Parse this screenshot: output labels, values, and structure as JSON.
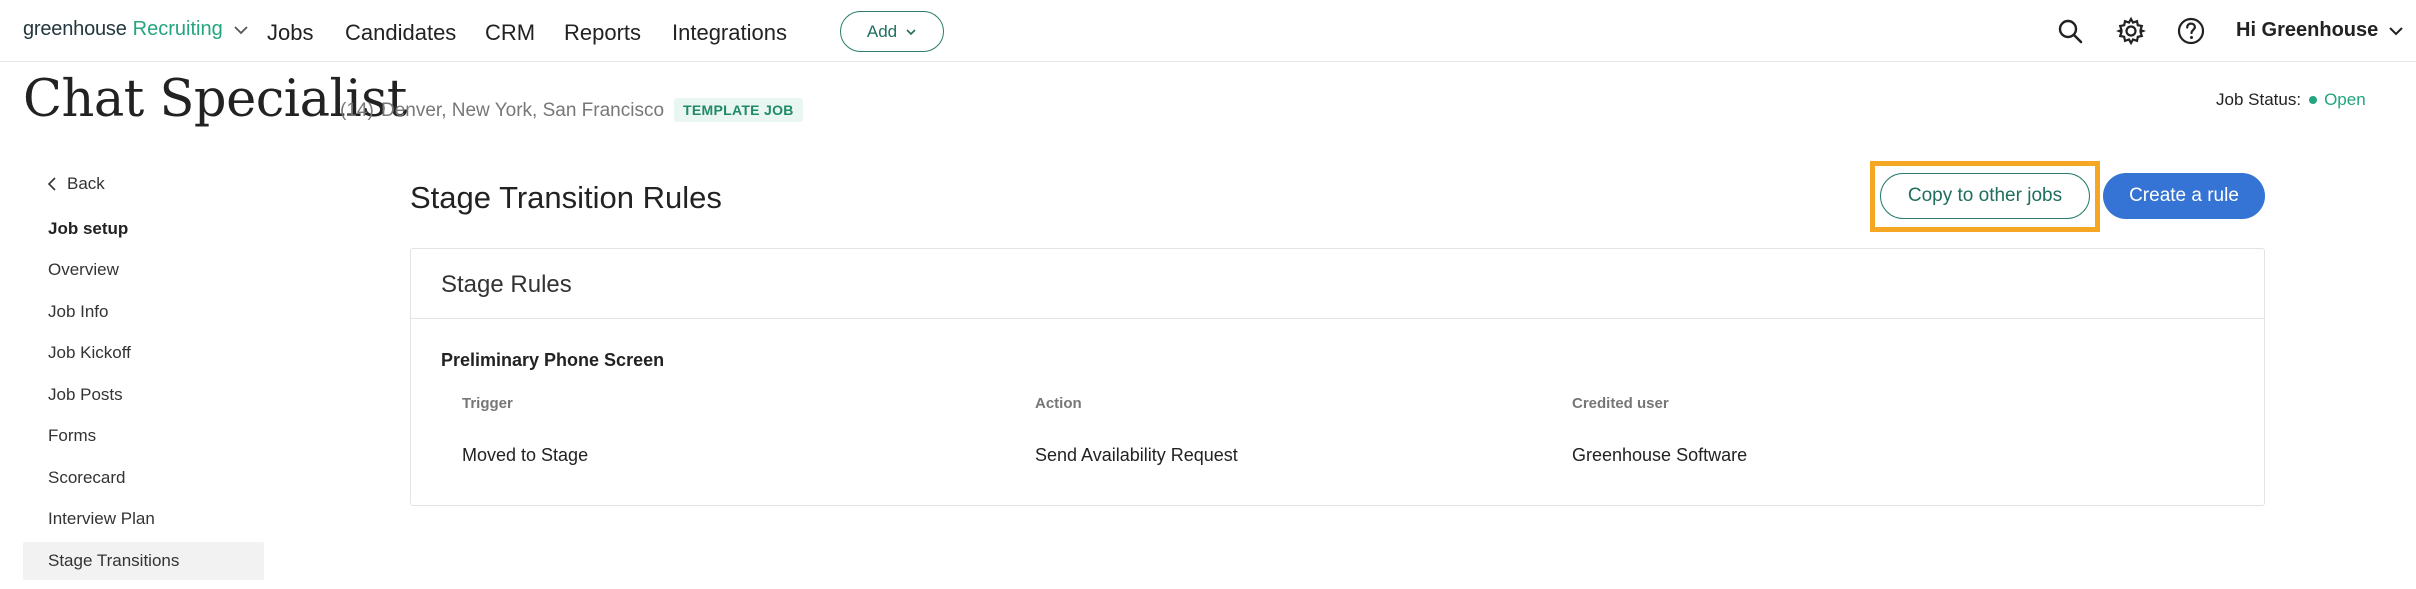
{
  "nav": {
    "brand": "greenhouse",
    "product": "Recruiting",
    "links": [
      "Jobs",
      "Candidates",
      "CRM",
      "Reports",
      "Integrations"
    ],
    "add_label": "Add",
    "greeting": "Hi Greenhouse"
  },
  "job": {
    "title": "Chat Specialist",
    "count": "(14)",
    "locations": "Denver, New York, San Francisco",
    "badge": "TEMPLATE JOB",
    "status_label": "Job Status:",
    "status_value": "Open"
  },
  "sidebar": {
    "back": "Back",
    "heading": "Job setup",
    "items": [
      {
        "label": "Overview"
      },
      {
        "label": "Job Info"
      },
      {
        "label": "Job Kickoff"
      },
      {
        "label": "Job Posts"
      },
      {
        "label": "Forms"
      },
      {
        "label": "Scorecard"
      },
      {
        "label": "Interview Plan"
      },
      {
        "label": "Stage Transitions"
      }
    ],
    "active": "Stage Transitions"
  },
  "main": {
    "title": "Stage Transition Rules",
    "copy_button": "Copy to other jobs",
    "create_button": "Create a rule",
    "card_title": "Stage Rules",
    "stage": "Preliminary Phone Screen",
    "columns": [
      "Trigger",
      "Action",
      "Credited user"
    ],
    "rows": [
      [
        "Moved to Stage",
        "Send Availability Request",
        "Greenhouse Software"
      ]
    ]
  },
  "colors": {
    "brand_green": "#24a47f",
    "primary_blue": "#3574d4",
    "highlight_orange": "#f5a623"
  },
  "icons": [
    "chevron-down-icon",
    "search-icon",
    "gear-icon",
    "help-icon",
    "chevron-left-icon"
  ]
}
